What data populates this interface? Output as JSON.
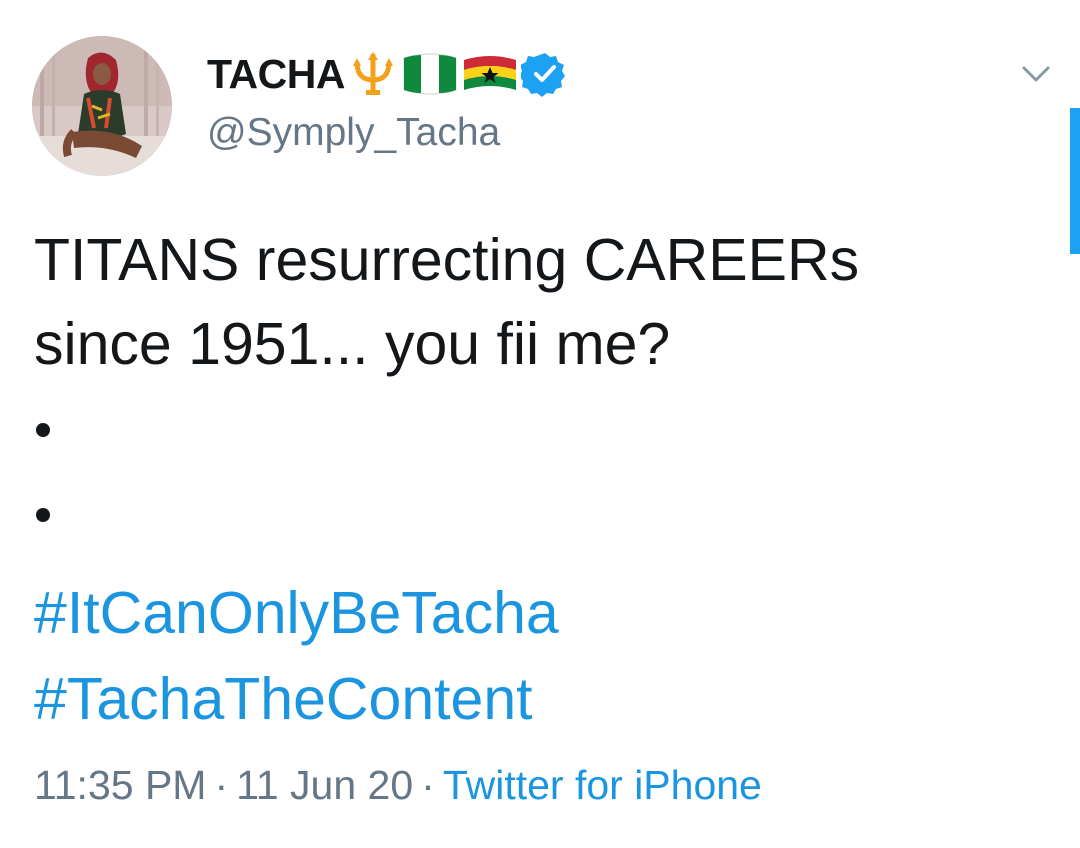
{
  "user": {
    "display_name": "TACHA",
    "handle": "@Symply_Tacha",
    "emojis": [
      "trident-emoji",
      "nigeria-flag-emoji",
      "ghana-flag-emoji"
    ],
    "verified": true
  },
  "tweet": {
    "lines": [
      "TITANS resurrecting CAREERs",
      "since 1951... you fii me?"
    ],
    "hashtags": [
      "#ItCanOnlyBeTacha",
      "#TachaTheContent"
    ]
  },
  "meta": {
    "time": "11:35 PM",
    "separator": "·",
    "date": "11 Jun 20",
    "source": "Twitter for iPhone"
  },
  "colors": {
    "text": "#14171a",
    "secondary": "#657786",
    "link": "#1b95e0",
    "verified": "#1da1f2"
  },
  "icons": {
    "menu": "chevron-down-icon",
    "verified": "verified-badge-icon"
  }
}
